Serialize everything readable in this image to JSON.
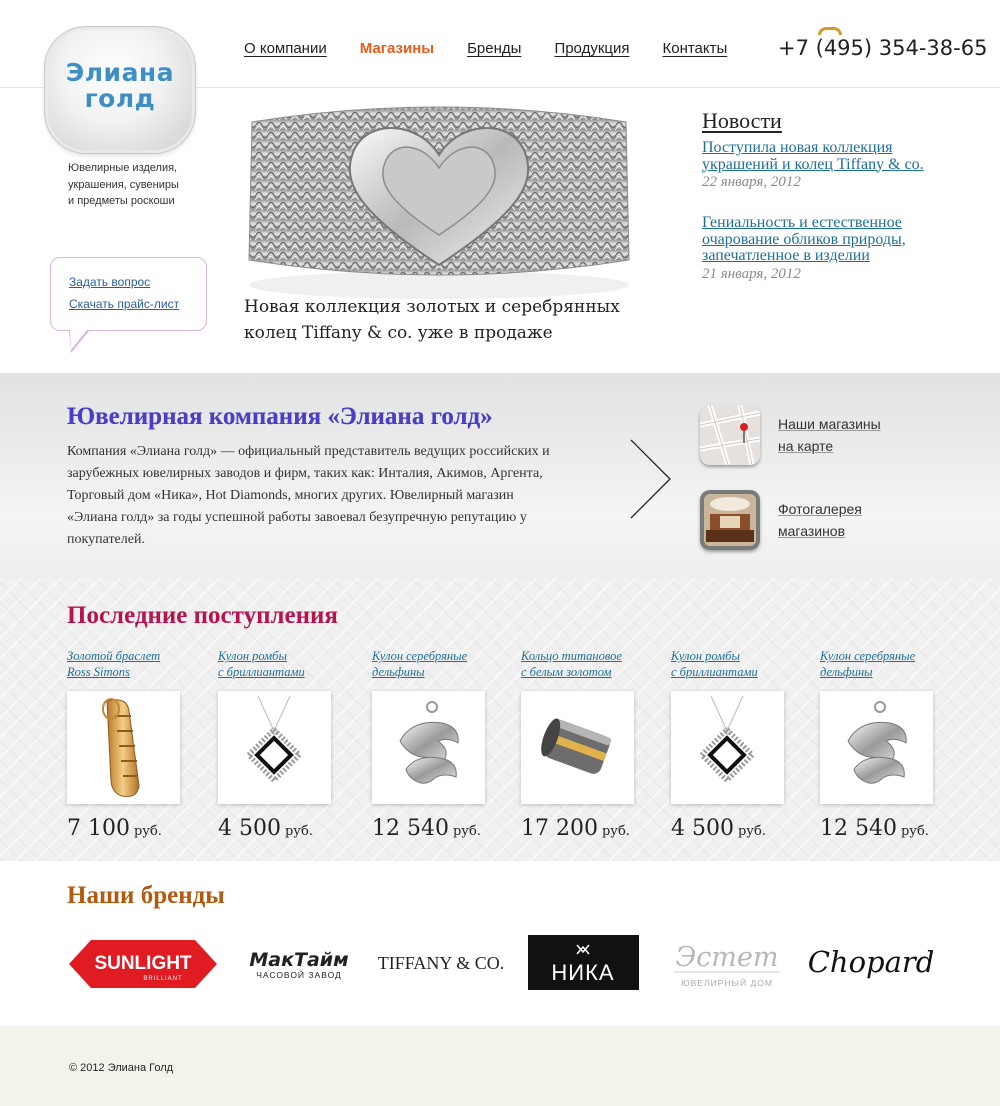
{
  "header": {
    "logo_text": "Элиана\nголд",
    "tagline": "Ювелирные изделия,\nукрашения, сувениры\nи предметы роскоши",
    "nav": [
      "О компании",
      "Магазины",
      "Бренды",
      "Продукция",
      "Контакты"
    ],
    "active_nav": "Магазины",
    "phone": "+7 (495) 354-38-65"
  },
  "ask_bubble": {
    "ask_question": "Задать вопрос",
    "download_price": "Скачать прайс-лист"
  },
  "hero": {
    "caption": "Новая коллекция золотых и серебрянных колец Tiffany & co. уже в продаже"
  },
  "news": {
    "title": "Новости",
    "items": [
      {
        "text": "Поступила новая коллекция украшений и колец Tiffany & co.",
        "date": "22 января, 2012"
      },
      {
        "text": "Гениальность и естественное очарование обликов природы, запечатленное в изделии",
        "date": "21 января, 2012"
      }
    ]
  },
  "company": {
    "title": "Ювелирная компания «Элиана голд»",
    "text": "Компания «Элиана голд» — официальный представитель ведущих российских и зарубежных ювелирных заводов и фирм, таких как: Инталия, Акимов, Аргента, Торговый дом «Ника», Hot Diamonds, многих других. Ювелирный магазин «Элиана голд» за годы успешной работы завоевал безупречную репутацию у покупателей.",
    "links": [
      {
        "label": "Наши магазины\nна карте",
        "icon": "map-icon"
      },
      {
        "label": "Фотогалерея\nмагазинов",
        "icon": "gallery-icon"
      }
    ]
  },
  "arrivals": {
    "title": "Последние поступления",
    "currency": "руб.",
    "products": [
      {
        "name": "Золотой браслет\nRoss Simons",
        "price": "7 100",
        "image": "gold-bracelet"
      },
      {
        "name": "Кулон ромбы\nс бриллиантами",
        "price": "4 500",
        "image": "diamond-pendant"
      },
      {
        "name": "Кулон серебряные\nдельфины",
        "price": "12 540",
        "image": "dolphin-pendant"
      },
      {
        "name": "Кольцо титановое\nс белым золотом",
        "price": "17 200",
        "image": "titanium-ring"
      },
      {
        "name": "Кулон ромбы\nс бриллиантами",
        "price": "4 500",
        "image": "diamond-pendant"
      },
      {
        "name": "Кулон серебряные\nдельфины",
        "price": "12 540",
        "image": "dolphin-pendant"
      }
    ]
  },
  "brands": {
    "title": "Наши бренды",
    "logos": [
      {
        "name": "SUNLIGHT",
        "sub": "BRILLIANT"
      },
      {
        "name": "МакТайм",
        "sub": "ЧАСОВОЙ ЗАВОД"
      },
      {
        "name": "TIFFANY & CO.",
        "sub": ""
      },
      {
        "name": "НИКА",
        "sub": ""
      },
      {
        "name": "Эстет",
        "sub": "ЮВЕЛИРНЫЙ ДОМ"
      },
      {
        "name": "Chopard",
        "sub": ""
      }
    ]
  },
  "footer": {
    "copyright": "© 2012 Элиана Голд"
  },
  "colors": {
    "accent_orange": "#e85d1a",
    "link_blue": "#1e6f96",
    "arrivals_title": "#b6134f",
    "brands_title": "#b25a10",
    "company_title": "#4a3ec8"
  }
}
